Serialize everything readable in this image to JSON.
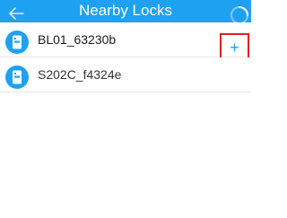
{
  "header": {
    "title": "Nearby Locks",
    "back_icon": "arrow-left-icon",
    "status_icon": "loading-spinner-icon"
  },
  "locks": [
    {
      "name": "BL01_63230b",
      "icon": "door-lock-icon",
      "action": "+"
    },
    {
      "name": "S202C_f4324e",
      "icon": "door-lock-icon"
    }
  ],
  "colors": {
    "accent": "#1fa1f1",
    "highlight": "#e02020"
  }
}
